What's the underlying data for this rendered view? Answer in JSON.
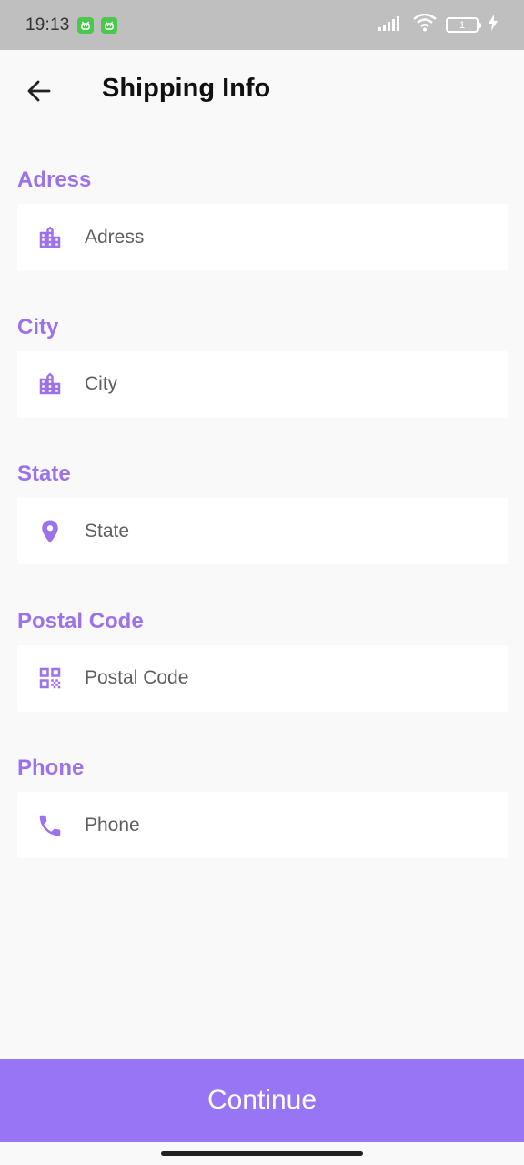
{
  "status_bar": {
    "time": "19:13",
    "battery_level": "1",
    "notification_icons": [
      "android-icon",
      "android-icon"
    ],
    "right_icons": [
      "signal-icon",
      "wifi-icon",
      "battery-icon",
      "charging-icon"
    ]
  },
  "header": {
    "back_icon": "arrow-left-icon",
    "title": "Shipping Info"
  },
  "form": {
    "fields": [
      {
        "label": "Adress",
        "placeholder": "Adress",
        "value": "",
        "icon": "building-icon"
      },
      {
        "label": "City",
        "placeholder": "City",
        "value": "",
        "icon": "building-icon"
      },
      {
        "label": "State",
        "placeholder": "State",
        "value": "",
        "icon": "location-pin-icon"
      },
      {
        "label": "Postal Code",
        "placeholder": "Postal Code",
        "value": "",
        "icon": "qr-code-icon"
      },
      {
        "label": "Phone",
        "placeholder": "Phone",
        "value": "",
        "icon": "phone-icon"
      }
    ]
  },
  "continue_label": "Continue",
  "colors": {
    "accent": "#9b72ea",
    "button": "#9775f5",
    "background": "#f9f9f9",
    "status_bar": "#bfbfbf"
  }
}
